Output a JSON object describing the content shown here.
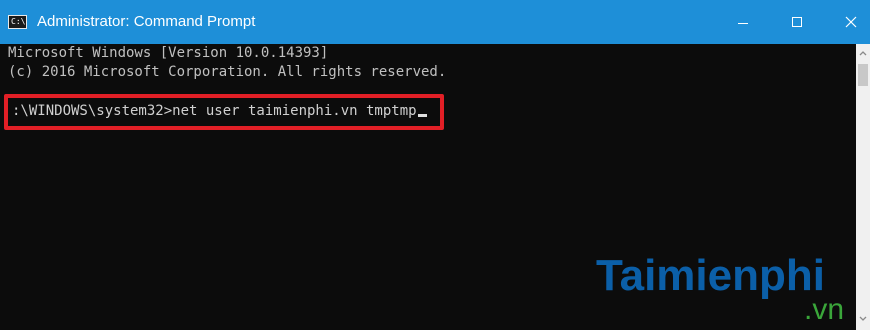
{
  "window": {
    "title": "Administrator: Command Prompt",
    "app_icon": "cmd-icon",
    "controls": [
      "minimize-icon",
      "maximize-icon",
      "close-icon"
    ]
  },
  "console": {
    "line1": "Microsoft Windows [Version 10.0.14393]",
    "line2": "(c) 2016 Microsoft Corporation. All rights reserved.",
    "command_line": ":\\WINDOWS\\system32>net user taimienphi.vn tmptmp"
  },
  "highlight": {
    "color": "#e21f26"
  },
  "watermark": {
    "name": "Taimienphi",
    "domain": ".vn"
  },
  "colors": {
    "titlebar": "#1e8fd8",
    "console_bg": "#0c0c0c",
    "console_text": "#c0c0c0",
    "watermark_blue": "#0b5fa8",
    "watermark_green": "#3aa63a"
  }
}
